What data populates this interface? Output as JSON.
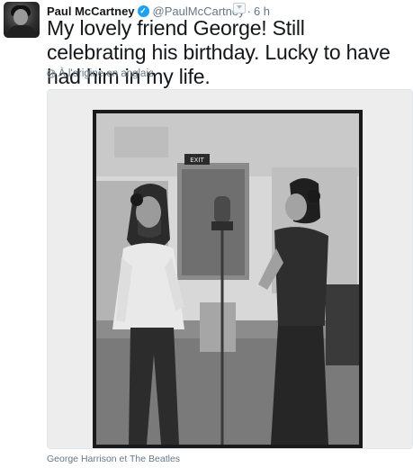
{
  "user": {
    "name": "Paul McCartney",
    "handle": "@PaulMcCartney",
    "separator": "·",
    "time": "6 h",
    "verified_mark": "✓"
  },
  "tweet": {
    "text": "My lovely friend George! Still celebrating his birthday. Lucky to have had him in my life.",
    "translation_label": "À l'origine en anglais"
  },
  "media": {
    "caption": "George Harrison et The Beatles",
    "sign_text": "EXIT"
  },
  "colors": {
    "accent": "#1da1f2",
    "muted": "#657786",
    "text": "#14171a"
  }
}
